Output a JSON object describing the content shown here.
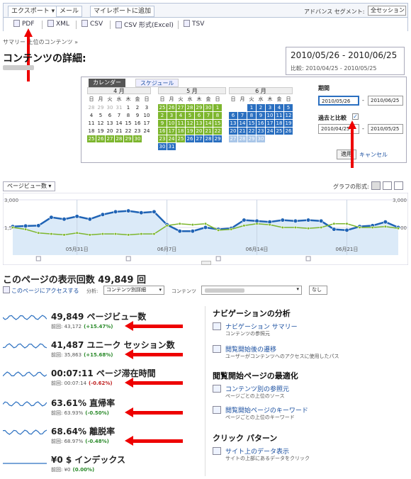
{
  "toolbar": {
    "tabs": [
      "エクスポート ▾",
      "メール",
      "マイレポートに追加"
    ],
    "advanced_segment_label": "アドバンス セグメント:",
    "segment_value": "全セッション",
    "export_items": [
      "PDF",
      "XML",
      "CSV",
      "CSV 形式(Excel)",
      "TSV"
    ]
  },
  "breadcrumb": "サマリー  上位のコンテンツ »",
  "page_title": "コンテンツの詳細:",
  "date_range": {
    "main": "2010/05/26 - 2010/06/25",
    "compare": "比較: 2010/04/25 - 2010/05/25"
  },
  "calendar": {
    "tabs": [
      "カレンダー",
      "スケジュール"
    ],
    "weekday_headers": [
      "日",
      "月",
      "火",
      "水",
      "木",
      "金",
      "日"
    ],
    "months": [
      {
        "label": "4 月",
        "rows": [
          [
            "28",
            "29",
            "30",
            "31",
            "1",
            "2",
            "3"
          ],
          [
            "4",
            "5",
            "6",
            "7",
            "8",
            "9",
            "10"
          ],
          [
            "11",
            "12",
            "13",
            "14",
            "15",
            "16",
            "17"
          ],
          [
            "18",
            "19",
            "20",
            "21",
            "22",
            "23",
            "24"
          ],
          [
            "25",
            "26",
            "27",
            "28",
            "29",
            "30",
            ""
          ]
        ]
      },
      {
        "label": "5 月",
        "rows": [
          [
            "25",
            "26",
            "27",
            "28",
            "29",
            "30",
            "1"
          ],
          [
            "2",
            "3",
            "4",
            "5",
            "6",
            "7",
            "8"
          ],
          [
            "9",
            "10",
            "11",
            "12",
            "13",
            "14",
            "15"
          ],
          [
            "16",
            "17",
            "18",
            "19",
            "20",
            "21",
            "22"
          ],
          [
            "23",
            "24",
            "25",
            "26",
            "27",
            "28",
            "29"
          ],
          [
            "30",
            "31",
            "",
            "",
            "",
            "",
            ""
          ]
        ]
      },
      {
        "label": "6 月",
        "rows": [
          [
            "",
            "",
            "1",
            "2",
            "3",
            "4",
            "5"
          ],
          [
            "6",
            "7",
            "8",
            "9",
            "10",
            "11",
            "12"
          ],
          [
            "13",
            "14",
            "15",
            "16",
            "17",
            "18",
            "19"
          ],
          [
            "20",
            "21",
            "22",
            "23",
            "24",
            "25",
            "26"
          ],
          [
            "27",
            "28",
            "29",
            "30",
            "",
            "",
            ""
          ]
        ]
      }
    ],
    "period_label": "期間",
    "period_start": "2010/05/26",
    "period_end": "2010/06/25",
    "compare_label": "過去と比較",
    "compare_checked": true,
    "compare_start": "2010/04/25",
    "compare_end": "2010/05/25",
    "apply_label": "適用",
    "cancel_label": "キャンセル"
  },
  "chart_controls": {
    "metric_select": "ページビュー数",
    "graph_format_label": "グラフの形式:"
  },
  "chart_data": {
    "type": "line",
    "ylim": [
      0,
      3000
    ],
    "y_tick_labels": [
      "3,000",
      "1,500"
    ],
    "x_tick_labels": [
      "05月31日",
      "06月7日",
      "06月14日",
      "06月21日"
    ],
    "series": [
      {
        "color": "#1f63b5",
        "values": [
          1550,
          1580,
          1600,
          2050,
          1950,
          2100,
          1950,
          2200,
          2350,
          2400,
          2300,
          2350,
          1650,
          1300,
          1300,
          1500,
          1400,
          1450,
          1900,
          1850,
          1800,
          1900,
          1850,
          1900,
          1850,
          1400,
          1350,
          1550,
          1600,
          1800,
          1500
        ]
      },
      {
        "color": "#7db62e",
        "values": [
          1500,
          1400,
          1200,
          1150,
          1100,
          1200,
          1100,
          1150,
          1150,
          1100,
          1150,
          1150,
          1600,
          1700,
          1650,
          1700,
          1350,
          1400,
          1600,
          1700,
          1650,
          1500,
          1500,
          1450,
          1500,
          1700,
          1700,
          1500,
          1500,
          1550,
          1450
        ]
      }
    ]
  },
  "stats": {
    "title": "このページの表示回数 49,849 回",
    "access_link": "このページにアクセスする",
    "analysis_label": "分析:",
    "analysis_value": "コンテンツ別詳細",
    "content_label": "コンテンツ",
    "none_label": "なし",
    "metrics": [
      {
        "value": "49,849 ページビュー数",
        "prev": "前回: 43,172",
        "change": "(+15.47%)",
        "dir": "pos"
      },
      {
        "value": "41,487 ユニーク セッション数",
        "prev": "前回: 35,863",
        "change": "(+15.68%)",
        "dir": "pos"
      },
      {
        "value": "00:07:11 ページ滞在時間",
        "prev": "前回: 00:07:14",
        "change": "(-0.62%)",
        "dir": "neg"
      },
      {
        "value": "63.61% 直帰率",
        "prev": "前回: 63.93%",
        "change": "(-0.50%)",
        "dir": "pos"
      },
      {
        "value": "68.64% 離脱率",
        "prev": "前回: 68.97%",
        "change": "(-0.48%)",
        "dir": "pos"
      },
      {
        "value": "¥0 $ インデックス",
        "prev": "前回: ¥0",
        "change": "(0.00%)",
        "dir": "pos"
      }
    ]
  },
  "right_panel": {
    "nav_heading": "ナビゲーションの分析",
    "nav_links": [
      {
        "title": "ナビゲーション サマリー",
        "desc": "コンテンツの参照元"
      },
      {
        "title": "閲覧開始後の遷移",
        "desc": "ユーザーがコンテンツへのアクセスに使用したパス"
      }
    ],
    "landing_heading": "閲覧開始ページの最適化",
    "landing_links": [
      {
        "title": "コンテンツ別の参照元",
        "desc": "ページごとの上位のソース"
      },
      {
        "title": "閲覧開始ページのキーワード",
        "desc": "ページごとの上位のキーワード"
      }
    ],
    "click_heading": "クリック パターン",
    "click_links": [
      {
        "title": "サイト上のデータ表示",
        "desc": "サイトの上部にあるデータをクリック"
      }
    ]
  }
}
